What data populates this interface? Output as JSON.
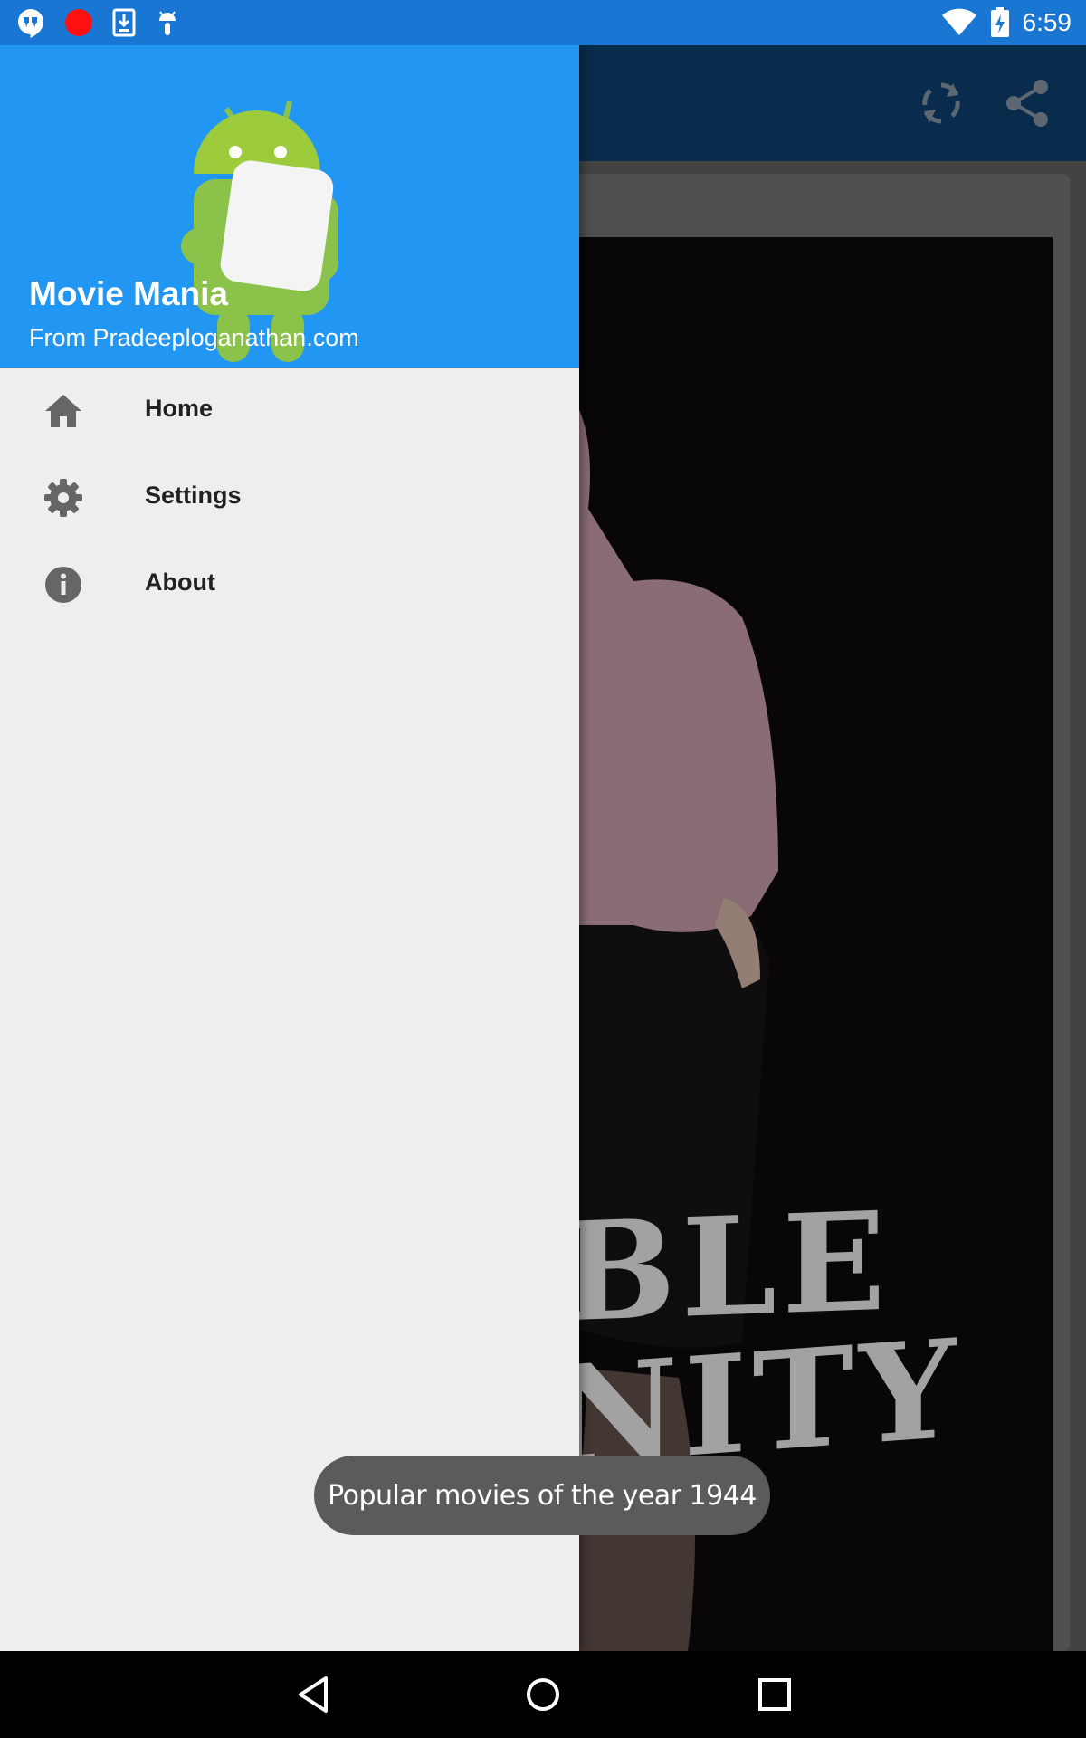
{
  "status_bar": {
    "time": "6:59",
    "left_icons": [
      "hangouts-icon",
      "record-icon",
      "download-icon",
      "android-debug-icon"
    ],
    "right_icons": [
      "wifi-icon",
      "battery-charging-icon"
    ]
  },
  "toolbar": {
    "icons": [
      "refresh-icon",
      "share-icon"
    ]
  },
  "poster": {
    "text_line1": "BLE",
    "text_line2": "NITY"
  },
  "drawer": {
    "header": {
      "title": "Movie Mania",
      "subtitle": "From Pradeeploganathan.com",
      "background_color": "#2196F3"
    },
    "items": [
      {
        "label": "Home",
        "icon": "home-icon"
      },
      {
        "label": "Settings",
        "icon": "gear-icon"
      },
      {
        "label": "About",
        "icon": "info-icon"
      }
    ]
  },
  "toast": {
    "message": "Popular movies of the year 1944"
  },
  "nav_bar": {
    "buttons": [
      "back-icon",
      "home-circle-icon",
      "recents-icon"
    ]
  }
}
